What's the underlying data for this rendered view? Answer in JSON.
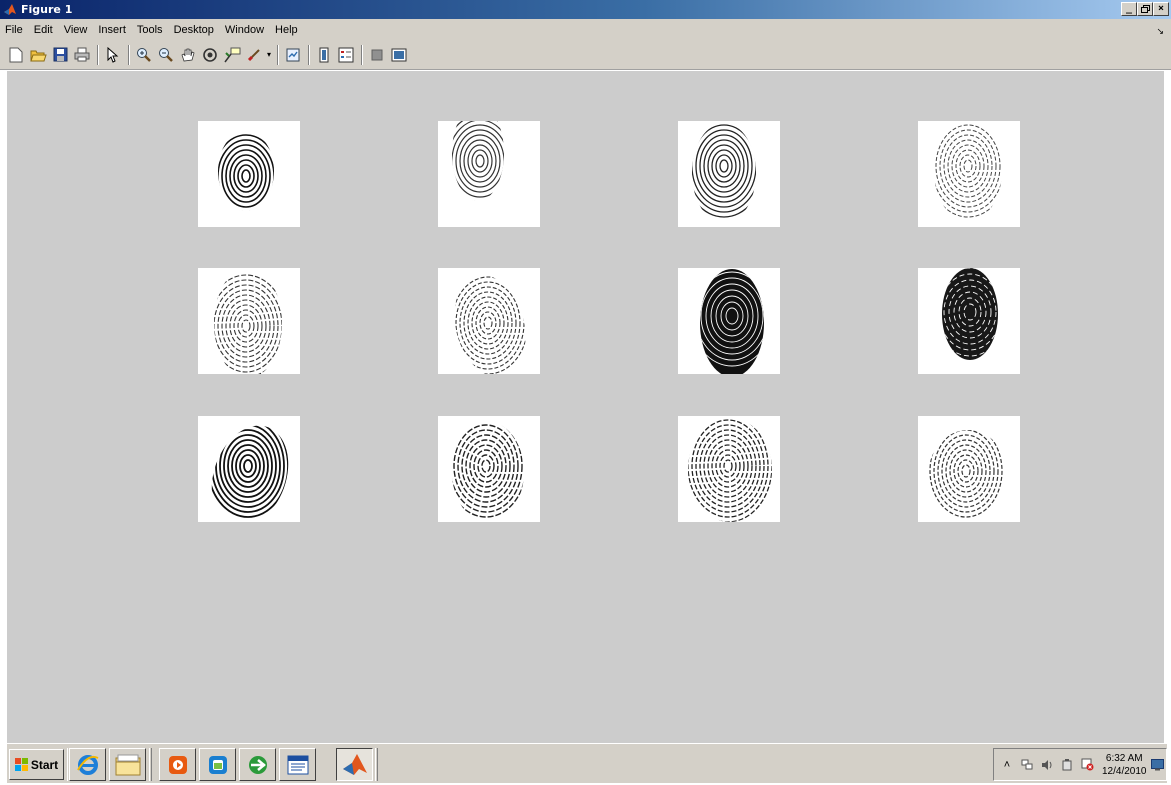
{
  "window": {
    "title": "Figure 1",
    "controls": {
      "minimize": "_",
      "restore": "đ",
      "close": "×"
    }
  },
  "menubar": {
    "items": [
      "File",
      "Edit",
      "View",
      "Insert",
      "Tools",
      "Desktop",
      "Window",
      "Help"
    ]
  },
  "toolbar": {
    "buttons": [
      "new-figure-icon",
      "open-file-icon",
      "save-icon",
      "print-icon",
      "edit-plot-icon",
      "zoom-in-icon",
      "zoom-out-icon",
      "pan-icon",
      "rotate-3d-icon",
      "data-cursor-icon",
      "brush-icon",
      "link-plot-icon",
      "colorbar-icon",
      "legend-icon",
      "hide-plot-tools-icon",
      "show-plot-tools-icon"
    ]
  },
  "figure": {
    "background": "#cccccc",
    "images": [
      "fingerprint-1",
      "fingerprint-2",
      "fingerprint-3",
      "fingerprint-4",
      "fingerprint-5",
      "fingerprint-6",
      "fingerprint-7",
      "fingerprint-8",
      "fingerprint-9",
      "fingerprint-10",
      "fingerprint-11",
      "fingerprint-12"
    ]
  },
  "taskbar": {
    "start_label": "Start",
    "apps": [
      "internet-explorer-icon",
      "file-manager-icon",
      "media-player-icon",
      "outlook-icon",
      "browser-icon",
      "word-icon",
      "matlab-icon"
    ],
    "active_app": "matlab-icon",
    "clock_time": "6:32 AM",
    "clock_date": "12/4/2010",
    "tray_expand": "˄"
  },
  "colors": {
    "titlebar_left": "#0a246a",
    "titlebar_right": "#a6caf0",
    "chrome": "#d4d0c8",
    "figure_bg": "#cccccc",
    "matlab_orange": "#e2571e"
  }
}
